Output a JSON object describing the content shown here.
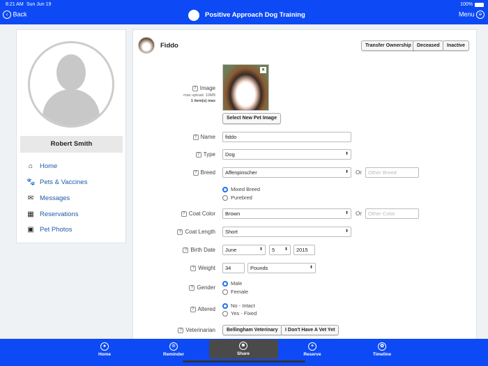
{
  "status": {
    "time": "8:21 AM",
    "date": "Sun Jun 19",
    "battery": "100%"
  },
  "header": {
    "back": "Back",
    "title": "Positive Approach Dog Training",
    "menu": "Menu"
  },
  "profile": {
    "name": "Robert Smith"
  },
  "sidebar": {
    "items": [
      {
        "label": "Home",
        "icon": "home-icon"
      },
      {
        "label": "Pets & Vaccines",
        "icon": "paw-icon"
      },
      {
        "label": "Messages",
        "icon": "envelope-icon"
      },
      {
        "label": "Reservations",
        "icon": "calendar-icon"
      },
      {
        "label": "Pet Photos",
        "icon": "photos-icon"
      }
    ]
  },
  "pet": {
    "name": "Fiddo",
    "actions": [
      "Transfer Ownership",
      "Deceased",
      "Inactive"
    ]
  },
  "form": {
    "image": {
      "label": "Image",
      "note1": "max upload: 10MB",
      "note2": "1 item(s) max",
      "button": "Select New Pet Image"
    },
    "name": {
      "label": "Name",
      "value": "fiddo"
    },
    "type": {
      "label": "Type",
      "value": "Dog"
    },
    "breed": {
      "label": "Breed",
      "value": "Affenpinscher",
      "or": "Or",
      "other_placeholder": "Other Breed",
      "options": [
        "Mixed Breed",
        "Purebred"
      ],
      "selected": "Mixed Breed"
    },
    "coat_color": {
      "label": "Coat Color",
      "value": "Brown",
      "or": "Or",
      "other_placeholder": "Other Color"
    },
    "coat_length": {
      "label": "Coat Length",
      "value": "Short"
    },
    "birth_date": {
      "label": "Birth Date",
      "month": "June",
      "day": "5",
      "year": "2015"
    },
    "weight": {
      "label": "Weight",
      "value": "34",
      "unit": "Pounds"
    },
    "gender": {
      "label": "Gender",
      "options": [
        "Male",
        "Female"
      ],
      "selected": "Male"
    },
    "altered": {
      "label": "Altered",
      "options": [
        "No - Intact",
        "Yes - Fixed"
      ],
      "selected": "No - Intact"
    },
    "vet": {
      "label": "Veterinarian",
      "buttons": [
        "Bellingham Veterinary",
        "I Don't Have A Vet Yet"
      ]
    }
  },
  "tabs": [
    {
      "label": "Home"
    },
    {
      "label": "Reminder"
    },
    {
      "label": "Share"
    },
    {
      "label": "Reserve"
    },
    {
      "label": "Timeline"
    }
  ],
  "colors": {
    "brand": "#0d4af5",
    "link": "#1f5aa8"
  }
}
